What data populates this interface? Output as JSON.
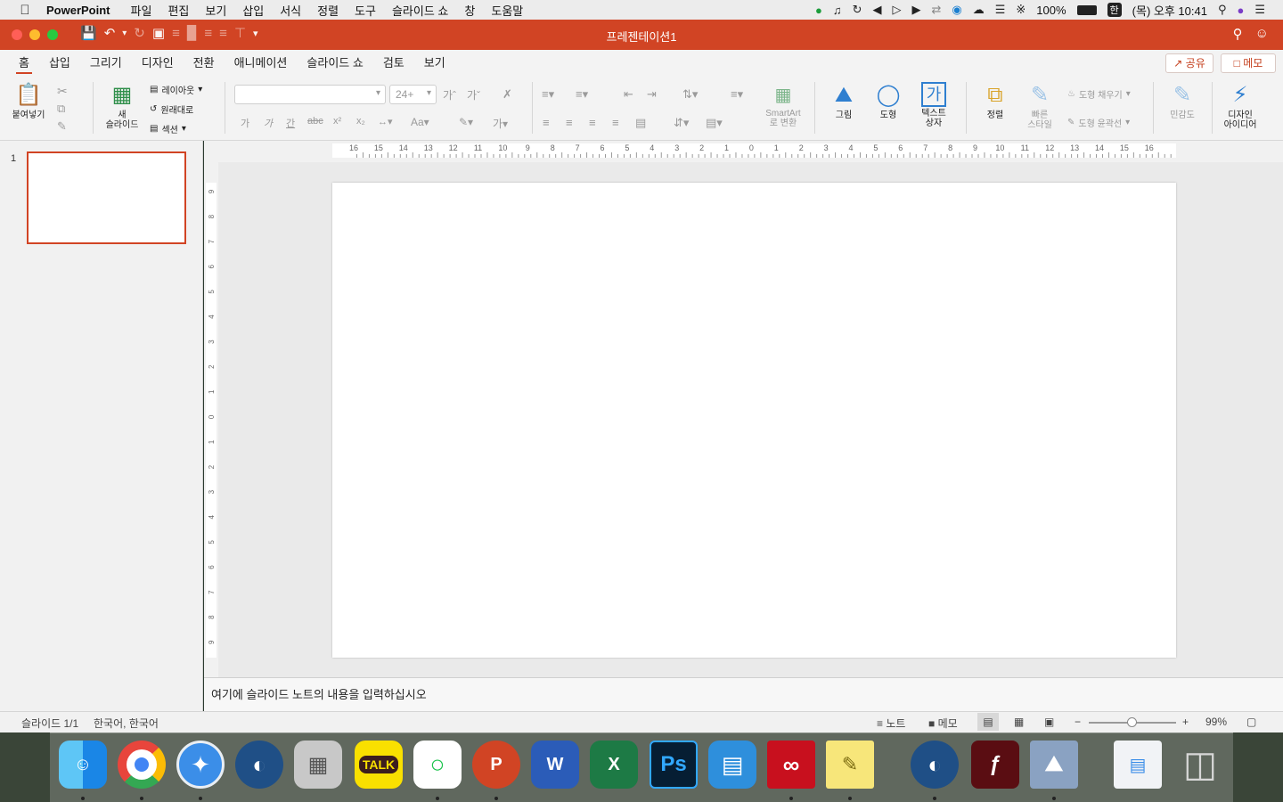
{
  "menubar": {
    "app_name": "PowerPoint",
    "items": [
      "파일",
      "편집",
      "보기",
      "삽입",
      "서식",
      "정렬",
      "도구",
      "슬라이드 쇼",
      "창",
      "도움말"
    ],
    "battery": "100%",
    "input_lang": "한",
    "clock": "(목) 오후 10:41"
  },
  "window": {
    "title": "프레젠테이션1"
  },
  "tabs": [
    "홈",
    "삽입",
    "그리기",
    "디자인",
    "전환",
    "애니메이션",
    "슬라이드 쇼",
    "검토",
    "보기"
  ],
  "share_label": "공유",
  "memo_label": "메모",
  "ribbon": {
    "paste": "붙여넣기",
    "new_slide_line1": "새",
    "new_slide_line2": "슬라이드",
    "layout": "레이아웃",
    "reset": "원래대로",
    "section": "섹션",
    "font_name": "",
    "font_size": "24+",
    "smartart_line1": "SmartArt",
    "smartart_line2": "로 변환",
    "picture": "그림",
    "shapes": "도형",
    "textbox_line1": "텍스트",
    "textbox_line2": "상자",
    "arrange": "정렬",
    "quick_style_line1": "빠른",
    "quick_style_line2": "스타일",
    "shape_fill": "도형 채우기",
    "shape_outline": "도형 윤곽선",
    "sensitivity": "민감도",
    "design_ideas_line1": "디자인",
    "design_ideas_line2": "아이디어"
  },
  "thumbnail": {
    "number": "1"
  },
  "notes_placeholder": "여기에 슬라이드 노트의 내용을 입력하십시오",
  "statusbar": {
    "slide_count": "슬라이드 1/1",
    "language": "한국어, 한국어",
    "notes_btn": "노트",
    "comments_btn": "메모",
    "zoom": "99%"
  },
  "ruler": {
    "h_ticks": [
      "16",
      "15",
      "14",
      "13",
      "12",
      "11",
      "10",
      "9",
      "8",
      "7",
      "6",
      "5",
      "4",
      "3",
      "2",
      "1",
      "0",
      "1",
      "2",
      "3",
      "4",
      "5",
      "6",
      "7",
      "8",
      "9",
      "10",
      "11",
      "12",
      "13",
      "14",
      "15",
      "16"
    ],
    "v_ticks": [
      "9",
      "8",
      "7",
      "6",
      "5",
      "4",
      "3",
      "2",
      "1",
      "0",
      "1",
      "2",
      "3",
      "4",
      "5",
      "6",
      "7",
      "8",
      "9"
    ]
  },
  "dock": {
    "word_letter": "W",
    "excel_letter": "X",
    "ppt_letter": "P",
    "ps_letters": "Ps",
    "talk": "TALK"
  },
  "colors": {
    "accent": "#d14424",
    "menubar": "#ececec",
    "ribbon": "#f3f3f3"
  }
}
